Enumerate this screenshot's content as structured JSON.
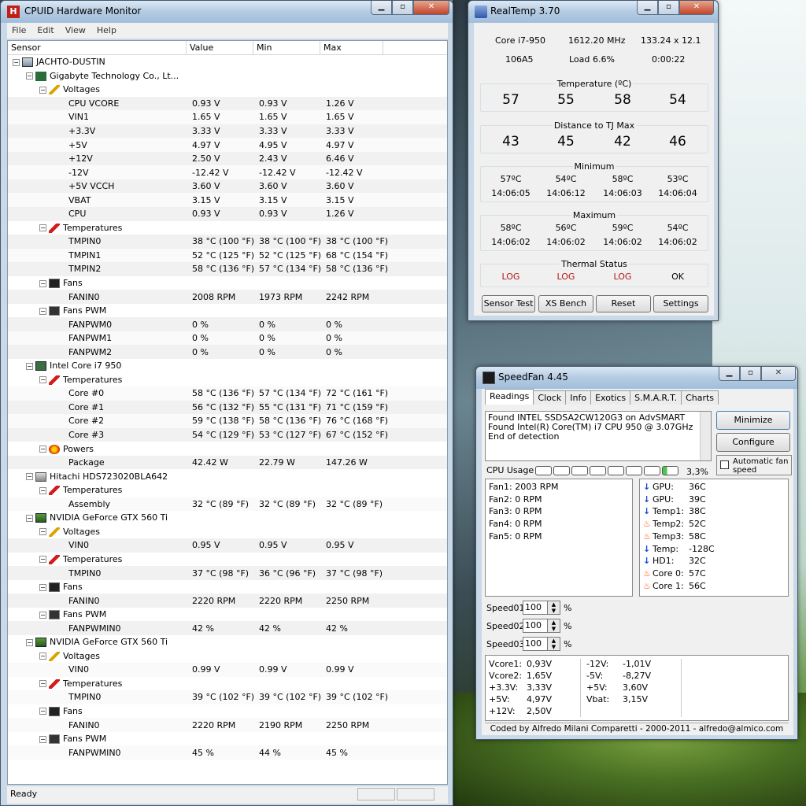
{
  "hm": {
    "title": "CPUID Hardware Monitor",
    "menu": [
      "File",
      "Edit",
      "View",
      "Help"
    ],
    "columns": [
      "Sensor",
      "Value",
      "Min",
      "Max"
    ],
    "status": "Ready",
    "rows": [
      {
        "lvl": 0,
        "type": "node",
        "icon": "computer-icon",
        "label": "JACHTO-DUSTIN"
      },
      {
        "lvl": 1,
        "type": "node",
        "icon": "motherboard-icon",
        "label": "Gigabyte Technology Co., Lt..."
      },
      {
        "lvl": 2,
        "type": "node",
        "icon": "voltage-icon",
        "label": "Voltages"
      },
      {
        "lvl": 3,
        "type": "leaf",
        "label": "CPU VCORE",
        "v": "0.93 V",
        "mn": "0.93 V",
        "mx": "1.26 V"
      },
      {
        "lvl": 3,
        "type": "leaf",
        "label": "VIN1",
        "v": "1.65 V",
        "mn": "1.65 V",
        "mx": "1.65 V"
      },
      {
        "lvl": 3,
        "type": "leaf",
        "label": "+3.3V",
        "v": "3.33 V",
        "mn": "3.33 V",
        "mx": "3.33 V"
      },
      {
        "lvl": 3,
        "type": "leaf",
        "label": "+5V",
        "v": "4.97 V",
        "mn": "4.95 V",
        "mx": "4.97 V"
      },
      {
        "lvl": 3,
        "type": "leaf",
        "label": "+12V",
        "v": "2.50 V",
        "mn": "2.43 V",
        "mx": "6.46 V"
      },
      {
        "lvl": 3,
        "type": "leaf",
        "label": "-12V",
        "v": "-12.42 V",
        "mn": "-12.42 V",
        "mx": "-12.42 V"
      },
      {
        "lvl": 3,
        "type": "leaf",
        "label": "+5V VCCH",
        "v": "3.60 V",
        "mn": "3.60 V",
        "mx": "3.60 V"
      },
      {
        "lvl": 3,
        "type": "leaf",
        "label": "VBAT",
        "v": "3.15 V",
        "mn": "3.15 V",
        "mx": "3.15 V"
      },
      {
        "lvl": 3,
        "type": "leaf",
        "label": "CPU",
        "v": "0.93 V",
        "mn": "0.93 V",
        "mx": "1.26 V"
      },
      {
        "lvl": 2,
        "type": "node",
        "icon": "thermometer-icon",
        "label": "Temperatures"
      },
      {
        "lvl": 3,
        "type": "leaf",
        "label": "TMPIN0",
        "v": "38 °C (100 °F)",
        "mn": "38 °C (100 °F)",
        "mx": "38 °C (100 °F)"
      },
      {
        "lvl": 3,
        "type": "leaf",
        "label": "TMPIN1",
        "v": "52 °C (125 °F)",
        "mn": "52 °C (125 °F)",
        "mx": "68 °C (154 °F)"
      },
      {
        "lvl": 3,
        "type": "leaf",
        "label": "TMPIN2",
        "v": "58 °C (136 °F)",
        "mn": "57 °C (134 °F)",
        "mx": "58 °C (136 °F)"
      },
      {
        "lvl": 2,
        "type": "node",
        "icon": "fan-icon",
        "label": "Fans"
      },
      {
        "lvl": 3,
        "type": "leaf",
        "label": "FANIN0",
        "v": "2008 RPM",
        "mn": "1973 RPM",
        "mx": "2242 RPM"
      },
      {
        "lvl": 2,
        "type": "node",
        "icon": "fan-pwm-icon",
        "label": "Fans PWM"
      },
      {
        "lvl": 3,
        "type": "leaf",
        "label": "FANPWM0",
        "v": "0 %",
        "mn": "0 %",
        "mx": "0 %"
      },
      {
        "lvl": 3,
        "type": "leaf",
        "label": "FANPWM1",
        "v": "0 %",
        "mn": "0 %",
        "mx": "0 %"
      },
      {
        "lvl": 3,
        "type": "leaf",
        "label": "FANPWM2",
        "v": "0 %",
        "mn": "0 %",
        "mx": "0 %"
      },
      {
        "lvl": 1,
        "type": "node",
        "icon": "cpu-chip-icon",
        "label": "Intel Core i7 950"
      },
      {
        "lvl": 2,
        "type": "node",
        "icon": "thermometer-icon",
        "label": "Temperatures"
      },
      {
        "lvl": 3,
        "type": "leaf",
        "label": "Core #0",
        "v": "58 °C (136 °F)",
        "mn": "57 °C (134 °F)",
        "mx": "72 °C (161 °F)"
      },
      {
        "lvl": 3,
        "type": "leaf",
        "label": "Core #1",
        "v": "56 °C (132 °F)",
        "mn": "55 °C (131 °F)",
        "mx": "71 °C (159 °F)"
      },
      {
        "lvl": 3,
        "type": "leaf",
        "label": "Core #2",
        "v": "59 °C (138 °F)",
        "mn": "58 °C (136 °F)",
        "mx": "76 °C (168 °F)"
      },
      {
        "lvl": 3,
        "type": "leaf",
        "label": "Core #3",
        "v": "54 °C (129 °F)",
        "mn": "53 °C (127 °F)",
        "mx": "67 °C (152 °F)"
      },
      {
        "lvl": 2,
        "type": "node",
        "icon": "power-icon",
        "label": "Powers"
      },
      {
        "lvl": 3,
        "type": "leaf",
        "label": "Package",
        "v": "42.42 W",
        "mn": "22.79 W",
        "mx": "147.26 W"
      },
      {
        "lvl": 1,
        "type": "node",
        "icon": "hard-drive-icon",
        "label": "Hitachi HDS723020BLA642"
      },
      {
        "lvl": 2,
        "type": "node",
        "icon": "thermometer-icon",
        "label": "Temperatures"
      },
      {
        "lvl": 3,
        "type": "leaf",
        "label": "Assembly",
        "v": "32 °C (89 °F)",
        "mn": "32 °C (89 °F)",
        "mx": "32 °C (89 °F)"
      },
      {
        "lvl": 1,
        "type": "node",
        "icon": "gpu-icon",
        "label": "NVIDIA GeForce GTX 560 Ti"
      },
      {
        "lvl": 2,
        "type": "node",
        "icon": "voltage-icon",
        "label": "Voltages"
      },
      {
        "lvl": 3,
        "type": "leaf",
        "label": "VIN0",
        "v": "0.95 V",
        "mn": "0.95 V",
        "mx": "0.95 V"
      },
      {
        "lvl": 2,
        "type": "node",
        "icon": "thermometer-icon",
        "label": "Temperatures"
      },
      {
        "lvl": 3,
        "type": "leaf",
        "label": "TMPIN0",
        "v": "37 °C (98 °F)",
        "mn": "36 °C (96 °F)",
        "mx": "37 °C (98 °F)"
      },
      {
        "lvl": 2,
        "type": "node",
        "icon": "fan-icon",
        "label": "Fans"
      },
      {
        "lvl": 3,
        "type": "leaf",
        "label": "FANIN0",
        "v": "2220 RPM",
        "mn": "2220 RPM",
        "mx": "2250 RPM"
      },
      {
        "lvl": 2,
        "type": "node",
        "icon": "fan-pwm-icon",
        "label": "Fans PWM"
      },
      {
        "lvl": 3,
        "type": "leaf",
        "label": "FANPWMIN0",
        "v": "42 %",
        "mn": "42 %",
        "mx": "42 %"
      },
      {
        "lvl": 1,
        "type": "node",
        "icon": "gpu-icon",
        "label": "NVIDIA GeForce GTX 560 Ti"
      },
      {
        "lvl": 2,
        "type": "node",
        "icon": "voltage-icon",
        "label": "Voltages"
      },
      {
        "lvl": 3,
        "type": "leaf",
        "label": "VIN0",
        "v": "0.99 V",
        "mn": "0.99 V",
        "mx": "0.99 V"
      },
      {
        "lvl": 2,
        "type": "node",
        "icon": "thermometer-icon",
        "label": "Temperatures"
      },
      {
        "lvl": 3,
        "type": "leaf",
        "label": "TMPIN0",
        "v": "39 °C (102 °F)",
        "mn": "39 °C (102 °F)",
        "mx": "39 °C (102 °F)"
      },
      {
        "lvl": 2,
        "type": "node",
        "icon": "fan-icon",
        "label": "Fans"
      },
      {
        "lvl": 3,
        "type": "leaf",
        "label": "FANIN0",
        "v": "2220 RPM",
        "mn": "2190 RPM",
        "mx": "2250 RPM"
      },
      {
        "lvl": 2,
        "type": "node",
        "icon": "fan-pwm-icon",
        "label": "Fans PWM"
      },
      {
        "lvl": 3,
        "type": "leaf",
        "label": "FANPWMIN0",
        "v": "45 %",
        "mn": "44 %",
        "mx": "45 %"
      }
    ]
  },
  "rt": {
    "title": "RealTemp 3.70",
    "cpu": "Core i7-950",
    "mhz": "1612.20 MHz",
    "mult": "133.24 x 12.1",
    "id": "106A5",
    "load_label": "Load",
    "load": "6.6%",
    "time": "0:00:22",
    "temp_label": "Temperature (ºC)",
    "temps": [
      "57",
      "55",
      "58",
      "54"
    ],
    "dist_label": "Distance to TJ Max",
    "dist": [
      "43",
      "45",
      "42",
      "46"
    ],
    "min_label": "Minimum",
    "min_t": [
      "57ºC",
      "54ºC",
      "58ºC",
      "53ºC"
    ],
    "min_time": [
      "14:06:05",
      "14:06:12",
      "14:06:03",
      "14:06:04"
    ],
    "max_label": "Maximum",
    "max_t": [
      "58ºC",
      "56ºC",
      "59ºC",
      "54ºC"
    ],
    "max_time": [
      "14:06:02",
      "14:06:02",
      "14:06:02",
      "14:06:02"
    ],
    "thermal_label": "Thermal Status",
    "thermal": [
      "LOG",
      "LOG",
      "LOG",
      "OK"
    ],
    "buttons": [
      "Sensor Test",
      "XS Bench",
      "Reset",
      "Settings"
    ]
  },
  "sf": {
    "title": "SpeedFan 4.45",
    "tabs": [
      "Readings",
      "Clock",
      "Info",
      "Exotics",
      "S.M.A.R.T.",
      "Charts"
    ],
    "log": [
      "Found INTEL SSDSA2CW120G3 on AdvSMART",
      "Found Intel(R) Core(TM) i7 CPU 950 @ 3.07GHz",
      "End of detection"
    ],
    "minimize": "Minimize",
    "configure": "Configure",
    "auto_fan": "Automatic fan speed",
    "cpu_usage_label": "CPU Usage",
    "cpu_usage": "3,3%",
    "fans": [
      "Fan1: 2003 RPM",
      "Fan2: 0 RPM",
      "Fan3: 0 RPM",
      "Fan4: 0 RPM",
      "Fan5: 0 RPM"
    ],
    "temps": [
      {
        "dir": "down",
        "label": "GPU:",
        "val": "36C"
      },
      {
        "dir": "down",
        "label": "GPU:",
        "val": "39C"
      },
      {
        "dir": "down",
        "label": "Temp1:",
        "val": "38C"
      },
      {
        "dir": "up",
        "label": "Temp2:",
        "val": "52C"
      },
      {
        "dir": "up",
        "label": "Temp3:",
        "val": "58C"
      },
      {
        "dir": "down",
        "label": "Temp:",
        "val": "-128C"
      },
      {
        "dir": "down",
        "label": "HD1:",
        "val": "32C"
      },
      {
        "dir": "up",
        "label": "Core 0:",
        "val": "57C"
      },
      {
        "dir": "up",
        "label": "Core 1:",
        "val": "56C"
      }
    ],
    "speeds": [
      {
        "label": "Speed01:",
        "val": "100",
        "unit": "%"
      },
      {
        "label": "Speed02:",
        "val": "100",
        "unit": "%"
      },
      {
        "label": "Speed03:",
        "val": "100",
        "unit": "%"
      }
    ],
    "volts_l": [
      [
        "Vcore1:",
        "0,93V"
      ],
      [
        "Vcore2:",
        "1,65V"
      ],
      [
        "+3.3V:",
        "3,33V"
      ],
      [
        "+5V:",
        "4,97V"
      ],
      [
        "+12V:",
        "2,50V"
      ]
    ],
    "volts_r": [
      [
        "-12V:",
        "-1,01V"
      ],
      [
        "-5V:",
        "-8,27V"
      ],
      [
        "+5V:",
        "3,60V"
      ],
      [
        "Vbat:",
        "3,15V"
      ]
    ],
    "footer": "Coded by Alfredo Milani Comparetti - 2000-2011 - alfredo@almico.com"
  }
}
